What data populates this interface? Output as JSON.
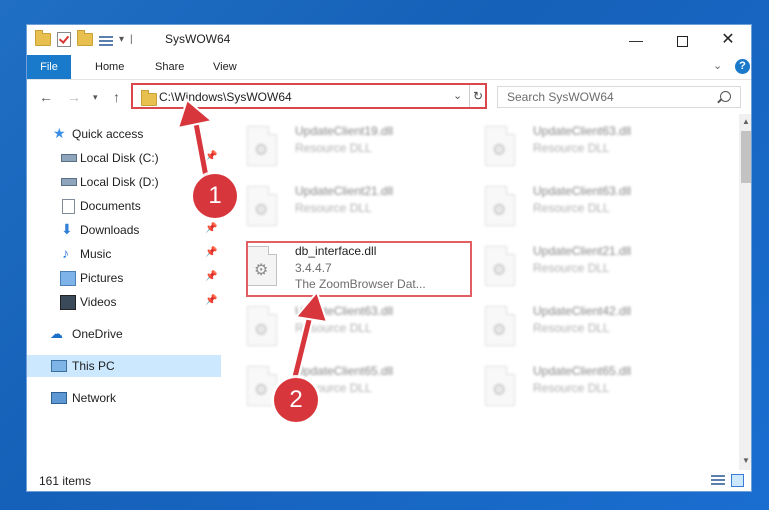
{
  "window": {
    "title": "SysWOW64"
  },
  "ribbon": {
    "tabs": [
      "File",
      "Home",
      "Share",
      "View"
    ],
    "help": "?"
  },
  "address": {
    "path": "C:\\Windows\\SysWOW64"
  },
  "search": {
    "placeholder": "Search SysWOW64"
  },
  "sidebar": {
    "items": [
      {
        "label": "Quick access"
      },
      {
        "label": "Local Disk (C:)"
      },
      {
        "label": "Local Disk (D:)"
      },
      {
        "label": "Documents"
      },
      {
        "label": "Downloads"
      },
      {
        "label": "Music"
      },
      {
        "label": "Pictures"
      },
      {
        "label": "Videos"
      },
      {
        "label": "OneDrive"
      },
      {
        "label": "This PC"
      },
      {
        "label": "Network"
      }
    ]
  },
  "files": {
    "left": [
      {
        "name": "UpdateClient19.dll",
        "type": "Resource DLL"
      },
      {
        "name": "UpdateClient21.dll",
        "type": "Resource DLL"
      },
      {
        "name": "db_interface.dll",
        "version": "3.4.4.7",
        "description": "The ZoomBrowser Dat..."
      },
      {
        "name": "UpdateClient63.dll",
        "type": "Resource DLL"
      },
      {
        "name": "UpdateClient65.dll",
        "type": "Resource DLL"
      }
    ],
    "right": [
      {
        "name": "UpdateClient63.dll",
        "type": "Resource DLL"
      },
      {
        "name": "UpdateClient63.dll",
        "type": "Resource DLL"
      },
      {
        "name": "UpdateClient21.dll",
        "type": "Resource DLL"
      },
      {
        "name": "UpdateClient42.dll",
        "type": "Resource DLL"
      },
      {
        "name": "UpdateClient65.dll",
        "type": "Resource DLL"
      }
    ]
  },
  "status": {
    "items": "161 items"
  },
  "callouts": {
    "one": "1",
    "two": "2"
  },
  "colors": {
    "accent": "#1979ca",
    "highlight": "#d9484d",
    "callout": "#d6363c",
    "selected": "#cce8ff"
  }
}
